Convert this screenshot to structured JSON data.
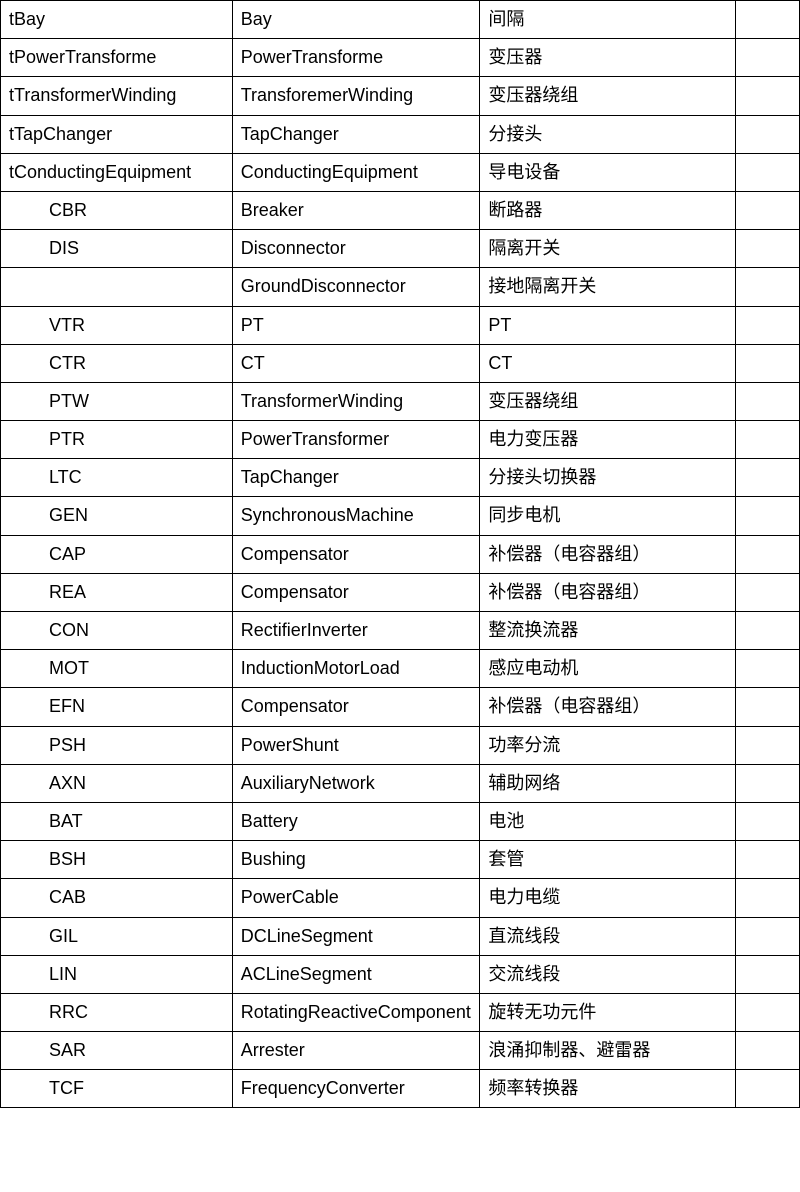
{
  "rows": [
    {
      "c1": "tBay",
      "c2": "Bay",
      "c3": "间隔",
      "indent": false
    },
    {
      "c1": "tPowerTransforme",
      "c2": "PowerTransforme",
      "c3": "变压器",
      "indent": false
    },
    {
      "c1": "tTransformerWinding",
      "c2": "TransforemerWinding",
      "c3": "变压器绕组",
      "indent": false
    },
    {
      "c1": "tTapChanger",
      "c2": "TapChanger",
      "c3": "分接头",
      "indent": false
    },
    {
      "c1": "tConductingEquipment",
      "c2": "ConductingEquipment",
      "c3": "导电设备",
      "indent": false
    },
    {
      "c1": "CBR",
      "c2": "Breaker",
      "c3": "断路器",
      "indent": true
    },
    {
      "c1": "DIS",
      "c2": "Disconnector",
      "c3": "隔离开关",
      "indent": true
    },
    {
      "c1": "",
      "c2": "GroundDisconnector",
      "c3": "接地隔离开关",
      "indent": true
    },
    {
      "c1": "VTR",
      "c2": "PT",
      "c3": "PT",
      "indent": true
    },
    {
      "c1": "CTR",
      "c2": "CT",
      "c3": "CT",
      "indent": true
    },
    {
      "c1": "PTW",
      "c2": "TransformerWinding",
      "c3": "变压器绕组",
      "indent": true
    },
    {
      "c1": "PTR",
      "c2": "PowerTransformer",
      "c3": "电力变压器",
      "indent": true
    },
    {
      "c1": "LTC",
      "c2": "TapChanger",
      "c3": "分接头切换器",
      "indent": true
    },
    {
      "c1": "GEN",
      "c2": "SynchronousMachine",
      "c3": "同步电机",
      "indent": true
    },
    {
      "c1": "CAP",
      "c2": "Compensator",
      "c3": "补偿器（电容器组）",
      "indent": true
    },
    {
      "c1": "REA",
      "c2": "Compensator",
      "c3": "补偿器（电容器组）",
      "indent": true
    },
    {
      "c1": "CON",
      "c2": "RectifierInverter",
      "c3": "整流换流器",
      "indent": true
    },
    {
      "c1": "MOT",
      "c2": "InductionMotorLoad",
      "c3": "感应电动机",
      "indent": true
    },
    {
      "c1": "EFN",
      "c2": "Compensator",
      "c3": "补偿器（电容器组）",
      "indent": true
    },
    {
      "c1": "PSH",
      "c2": "PowerShunt",
      "c3": "功率分流",
      "indent": true
    },
    {
      "c1": "AXN",
      "c2": "AuxiliaryNetwork",
      "c3": "辅助网络",
      "indent": true
    },
    {
      "c1": "BAT",
      "c2": "Battery",
      "c3": "电池",
      "indent": true
    },
    {
      "c1": "BSH",
      "c2": "Bushing",
      "c3": "套管",
      "indent": true
    },
    {
      "c1": "CAB",
      "c2": "PowerCable",
      "c3": "电力电缆",
      "indent": true
    },
    {
      "c1": "GIL",
      "c2": "DCLineSegment",
      "c3": "直流线段",
      "indent": true
    },
    {
      "c1": "LIN",
      "c2": "ACLineSegment",
      "c3": "交流线段",
      "indent": true
    },
    {
      "c1": "RRC",
      "c2": "RotatingReactiveComponent",
      "c3": "旋转无功元件",
      "indent": true
    },
    {
      "c1": "SAR",
      "c2": "Arrester",
      "c3": "浪涌抑制器、避雷器",
      "indent": true
    },
    {
      "c1": "TCF",
      "c2": "FrequencyConverter",
      "c3": "频率转换器",
      "indent": true
    }
  ]
}
